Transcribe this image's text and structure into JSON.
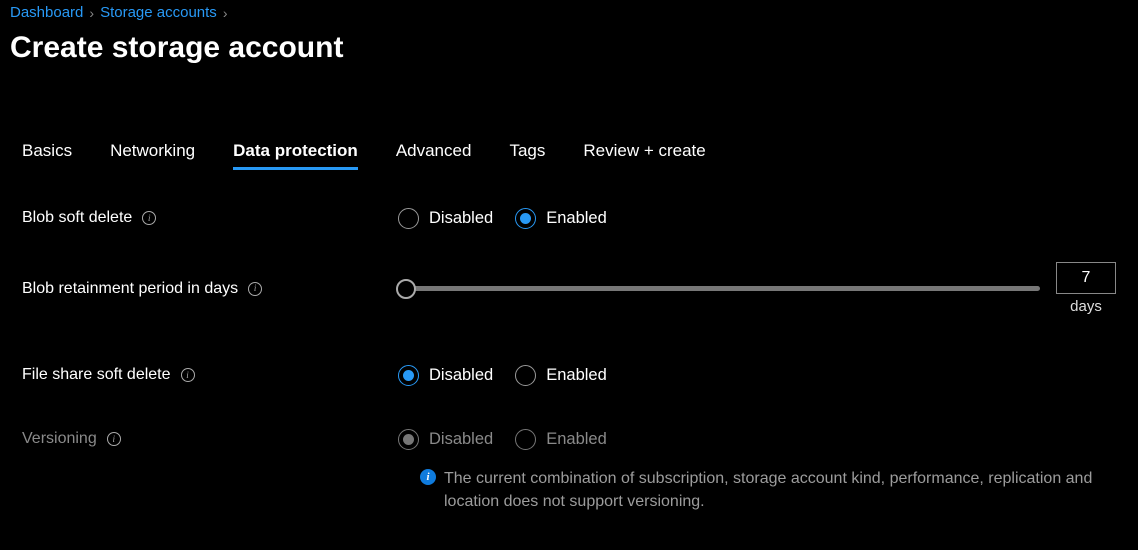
{
  "breadcrumb": {
    "items": [
      "Dashboard",
      "Storage accounts"
    ]
  },
  "page": {
    "title": "Create storage account"
  },
  "tabs": [
    {
      "label": "Basics",
      "active": false
    },
    {
      "label": "Networking",
      "active": false
    },
    {
      "label": "Data protection",
      "active": true
    },
    {
      "label": "Advanced",
      "active": false
    },
    {
      "label": "Tags",
      "active": false
    },
    {
      "label": "Review + create",
      "active": false
    }
  ],
  "form": {
    "blob_soft_delete": {
      "label": "Blob soft delete",
      "options": {
        "disabled": "Disabled",
        "enabled": "Enabled"
      },
      "value": "enabled"
    },
    "blob_retainment": {
      "label": "Blob retainment period in days",
      "value": "7",
      "unit": "days",
      "min": 1,
      "max": 365
    },
    "file_share_soft_delete": {
      "label": "File share soft delete",
      "options": {
        "disabled": "Disabled",
        "enabled": "Enabled"
      },
      "value": "disabled"
    },
    "versioning": {
      "label": "Versioning",
      "options": {
        "disabled": "Disabled",
        "enabled": "Enabled"
      },
      "value": "disabled",
      "disabled": true,
      "message": "The current combination of subscription, storage account kind, performance, replication and location does not support versioning."
    }
  }
}
